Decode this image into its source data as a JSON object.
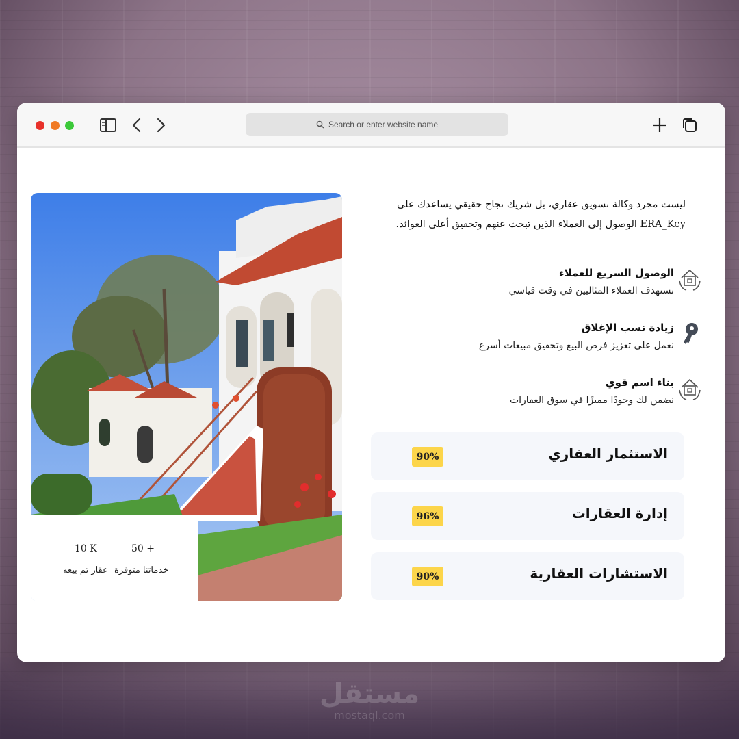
{
  "browser": {
    "search_placeholder": "Search or enter website name"
  },
  "intro": {
    "text": "ليست مجرد وكالة تسويق عقاري، بل شريك نجاح حقيقي يساعدك على ERA_Key الوصول إلى العملاء الذين تبحث عنهم وتحقيق أعلى العوائد."
  },
  "features": [
    {
      "title": "الوصول السريع للعملاء",
      "desc": "نستهدف العملاء المثاليين في وقت قياسي",
      "icon": "house-hands-icon"
    },
    {
      "title": "زيادة نسب الإغلاق",
      "desc": "نعمل على تعزيز فرص البيع وتحقيق مبيعات أسرع",
      "icon": "key-icon"
    },
    {
      "title": "بناء اسم قوي",
      "desc": "نضمن لك وجودًا مميزًا في سوق العقارات",
      "icon": "house-hands-icon"
    }
  ],
  "skills": [
    {
      "label": "الاستثمار العقاري",
      "value": "90%"
    },
    {
      "label": "إدارة العقارات",
      "value": "96%"
    },
    {
      "label": "الاستشارات العقارية",
      "value": "90%"
    }
  ],
  "stats": [
    {
      "number": "10 K",
      "label": "عقار تم بيعه"
    },
    {
      "number": "50 +",
      "label": "خدماتنا متوفرة"
    }
  ],
  "watermark": {
    "logo": "مستقل",
    "sub": "mostaql.com"
  },
  "colors": {
    "badge": "#fcd54a",
    "card_bg": "#f5f7fb"
  }
}
